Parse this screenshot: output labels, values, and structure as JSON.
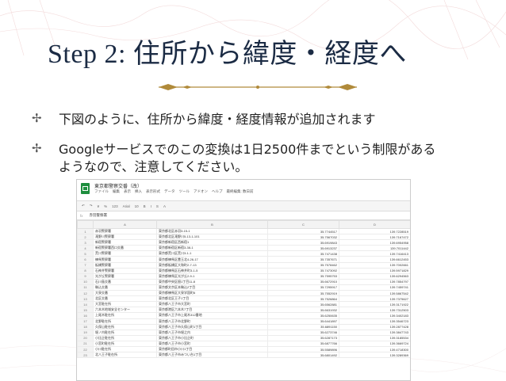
{
  "slide": {
    "title": "Step 2: 住所から緯度・経度へ",
    "bullet_mark": "✢",
    "bullets": [
      "下図のように、住所から緯度・経度情報が追加されます",
      "Googleサービスでのこの変換は1日2500件までという制限がある",
      "ようなので、注意してください。"
    ]
  },
  "sheet": {
    "name": "東京都警察交番（改）",
    "menu": [
      "ファイル",
      "編集",
      "表示",
      "挿入",
      "表示形式",
      "データ",
      "ツール",
      "アドオン",
      "ヘルプ",
      "最終編集: 数日前"
    ],
    "toolbar": [
      "↶",
      "↷",
      "¥",
      "%",
      "123",
      "Arial",
      "10",
      "B",
      "I",
      "S",
      "A"
    ],
    "formula_label": "fx",
    "formula_value": "赤羽警察署",
    "columns": [
      "",
      "A",
      "B",
      "C",
      "D"
    ],
    "rows": [
      [
        "1",
        "赤羽警察署",
        "東京都北区赤羽3-15-1",
        "35.7744517",
        "139.7228519"
      ],
      [
        "2",
        "滝野川警察署",
        "東京都北区滝野川5-13-1-101",
        "35.7567032",
        "139.7167472"
      ],
      [
        "3",
        "新宿警察署",
        "東京都新宿区西新宿1",
        "35.6919843",
        "139.6954958"
      ],
      [
        "4",
        "新宿警察署西口交番",
        "東京都新宿区新宿3-38-1",
        "35.6913237",
        "139.7011442"
      ],
      [
        "5",
        "荒川警察署",
        "東京都荒川区荒川3-1-1",
        "35.7471438",
        "139.7416413"
      ],
      [
        "6",
        "練馬警察署",
        "東京都練馬区豊玉北4-26-17",
        "35.7357671",
        "139.6612453"
      ],
      [
        "7",
        "板橋警察署",
        "東京都板橋区大和町2-7-13",
        "35.7578462",
        "139.7002661"
      ],
      [
        "8",
        "石神井警察署",
        "東京都練馬区石神井町3-1-5",
        "35.7473092",
        "139.5971829"
      ],
      [
        "9",
        "光が丘警察署",
        "東京都練馬区光が丘2-9-1",
        "35.7595753",
        "139.6294563"
      ],
      [
        "10",
        "石川島交番",
        "東京都中央区佃1丁目11-8",
        "35.6672910",
        "139.7854797"
      ],
      [
        "11",
        "駒込交番",
        "東京都文京区本駒込2丁目",
        "35.7295917",
        "139.7459741"
      ],
      [
        "12",
        "大泉交番",
        "東京都練馬区大泉学園町6",
        "35.7552919",
        "139.5867542"
      ],
      [
        "13",
        "北区交番",
        "東京都北区王子1丁目",
        "35.7526864",
        "139.7375627"
      ],
      [
        "14",
        "大宮駐在所",
        "東京都八王子市大宮町",
        "35.6562881",
        "139.3171922"
      ],
      [
        "15",
        "六本木地域安全センター",
        "東京都港区六本木7丁目",
        "35.6631932",
        "139.7312503"
      ],
      [
        "16",
        "上尾木駐在所",
        "東京都八王子市上尾木312番地",
        "35.6250635",
        "139.3402183"
      ],
      [
        "17",
        "北野駐在所",
        "東京都八王子市北野町",
        "35.6441897",
        "139.3546723"
      ],
      [
        "18",
        "久保山駐在所",
        "東京都八王子市久保山町1丁目",
        "35.6891150",
        "139.2877428"
      ],
      [
        "19",
        "堀ノ内駐在所",
        "東京都八王子市堀之内",
        "35.6273746",
        "139.3847743"
      ],
      [
        "20",
        "小比企駐在所",
        "東京都八王子市小比企町",
        "35.6287173",
        "139.3185534"
      ],
      [
        "21",
        "小宮町駐在所",
        "東京都八王子市小宮町",
        "35.6877766",
        "139.3669724"
      ],
      [
        "22",
        "小川駐在所",
        "東京都町田市小川1丁目",
        "35.5589896",
        "139.4718300"
      ],
      [
        "23",
        "北八王子駐在所",
        "東京都八王子市みつい台1丁目",
        "35.6801492",
        "139.3289369"
      ]
    ]
  }
}
